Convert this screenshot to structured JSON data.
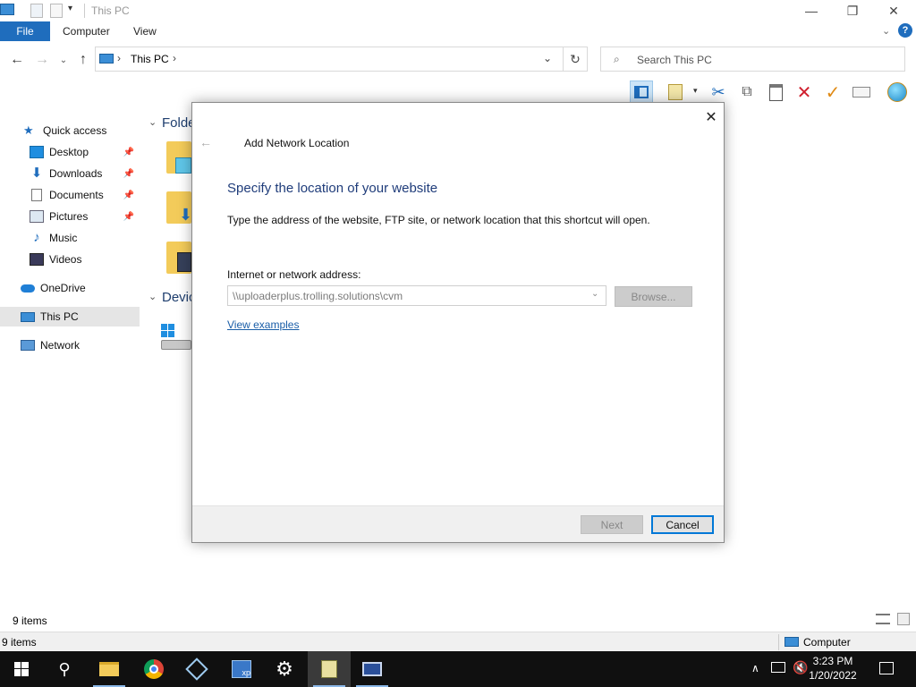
{
  "window": {
    "title": "This PC",
    "controls": {
      "minimize": "—",
      "restore": "❐",
      "close": "✕"
    }
  },
  "ribbon": {
    "tabs": [
      {
        "label": "File"
      },
      {
        "label": "Computer"
      },
      {
        "label": "View"
      }
    ]
  },
  "address": {
    "path_root": "This PC",
    "search_placeholder": "Search This PC"
  },
  "nav": {
    "quick_access": "Quick access",
    "items": [
      {
        "label": "Desktop",
        "pinned": true
      },
      {
        "label": "Downloads",
        "pinned": true
      },
      {
        "label": "Documents",
        "pinned": true
      },
      {
        "label": "Pictures",
        "pinned": true
      },
      {
        "label": "Music",
        "pinned": false
      },
      {
        "label": "Videos",
        "pinned": false
      }
    ],
    "onedrive": "OneDrive",
    "this_pc": "This PC",
    "network": "Network"
  },
  "content": {
    "folders_header": "Folde",
    "devices_header": "Devic"
  },
  "status": {
    "items_count": "9 items",
    "details_count": "9 items",
    "details_location": "Computer"
  },
  "dialog": {
    "title": "Add Network Location",
    "heading": "Specify the location of your website",
    "description": "Type the address of the website, FTP site, or network location that this shortcut will open.",
    "field_label": "Internet or network address:",
    "field_value": "\\\\uploaderplus.trolling.solutions\\cvm",
    "browse_label": "Browse...",
    "examples_link": "View examples",
    "next_label": "Next",
    "cancel_label": "Cancel"
  },
  "taskbar": {
    "time": "3:23 PM",
    "date": "1/20/2022"
  },
  "colors": {
    "accent": "#1f6dbd",
    "dialog_heading": "#1f3c7a",
    "link": "#1a5ea8",
    "taskbar": "#101010"
  }
}
